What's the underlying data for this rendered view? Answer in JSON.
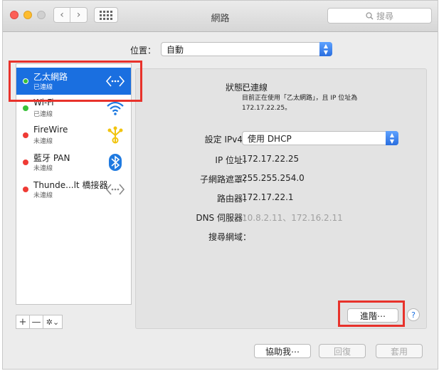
{
  "window": {
    "title": "網路"
  },
  "toolbar": {
    "search_placeholder": "搜尋",
    "back_glyph": "‹",
    "forward_glyph": "›"
  },
  "location": {
    "label": "位置：",
    "value": "自動"
  },
  "sidebar": {
    "services": [
      {
        "name": "乙太網路",
        "status": "已連線",
        "state_color": "green",
        "icon": "ethernet-icon",
        "selected": true
      },
      {
        "name": "Wi-Fi",
        "status": "已連線",
        "state_color": "green",
        "icon": "wifi-icon",
        "selected": false
      },
      {
        "name": "FireWire",
        "status": "未連線",
        "state_color": "red",
        "icon": "firewire-icon",
        "selected": false
      },
      {
        "name": "藍牙 PAN",
        "status": "未連線",
        "state_color": "red",
        "icon": "bluetooth-icon",
        "selected": false
      },
      {
        "name": "Thunde...lt 橋接器",
        "status": "未連線",
        "state_color": "red",
        "icon": "thunderbolt-bridge-icon",
        "selected": false
      }
    ],
    "add_label": "+",
    "remove_label": "—",
    "action_label": "✲⌄"
  },
  "detail": {
    "status_label": "狀態：",
    "status_value": "已連線",
    "status_note_line1": "目前正在使用「乙太網路」，且 IP 位址為",
    "status_note_line2": "172.17.22.25。",
    "configure_label": "設定 IPv4：",
    "configure_value": "使用 DHCP",
    "ip_label": "IP 位址：",
    "ip_value": "172.17.22.25",
    "subnet_label": "子網路遮罩：",
    "subnet_value": "255.255.254.0",
    "router_label": "路由器：",
    "router_value": "172.17.22.1",
    "dns_label": "DNS 伺服器：",
    "dns_value": "10.8.2.11、172.16.2.11",
    "search_domains_label": "搜尋網域：",
    "advanced_label": "進階⋯",
    "help_label": "?"
  },
  "footer": {
    "assist_label": "協助我⋯",
    "revert_label": "回復",
    "apply_label": "套用"
  },
  "colors": {
    "selection": "#1a6fe0",
    "highlight": "#e8322b",
    "connected": "#39c13a",
    "disconnected": "#ef3b35"
  }
}
